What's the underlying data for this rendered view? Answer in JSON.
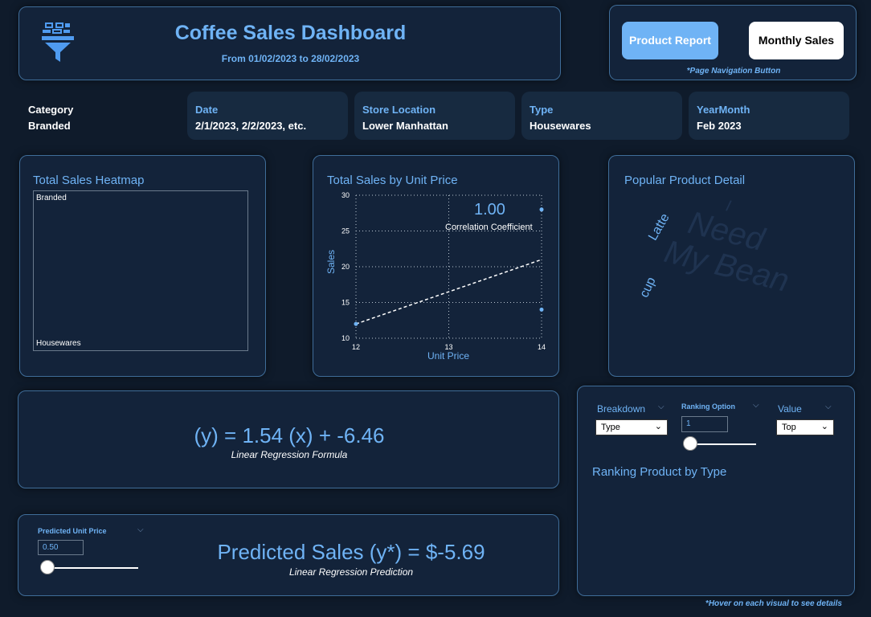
{
  "header": {
    "title": "Coffee Sales Dashboard",
    "subtitle": "From 01/02/2023 to 28/02/2023",
    "icon": "funnel-icon"
  },
  "nav": {
    "product_report": "Product Report",
    "monthly_sales": "Monthly Sales",
    "note": "*Page Navigation Button"
  },
  "filters": {
    "category": {
      "label": "Category",
      "value": "Branded"
    },
    "date": {
      "label": "Date",
      "value": "2/1/2023, 2/2/2023, etc."
    },
    "store": {
      "label": "Store Location",
      "value": "Lower Manhattan"
    },
    "type": {
      "label": "Type",
      "value": "Housewares"
    },
    "yearmonth": {
      "label": "YearMonth",
      "value": "Feb 2023"
    }
  },
  "heatmap": {
    "title": "Total Sales Heatmap",
    "top_label": "Branded",
    "bottom_label": "Housewares"
  },
  "scatter": {
    "title": "Total Sales by Unit Price",
    "correlation_value": "1.00",
    "correlation_label": "Correlation Coefficient"
  },
  "chart_data": {
    "type": "scatter",
    "title": "Total Sales by Unit Price",
    "xlabel": "Unit Price",
    "ylabel": "Sales",
    "xlim": [
      12,
      14
    ],
    "ylim": [
      10,
      30
    ],
    "x_ticks": [
      "12",
      "13",
      "14"
    ],
    "y_ticks": [
      "10",
      "15",
      "20",
      "25",
      "30"
    ],
    "points": [
      {
        "x": 12,
        "y": 12
      },
      {
        "x": 14,
        "y": 28
      },
      {
        "x": 14,
        "y": 14
      }
    ],
    "trendline": [
      {
        "x": 12,
        "y": 12
      },
      {
        "x": 14,
        "y": 21
      }
    ],
    "grid": true
  },
  "wordcloud": {
    "title": "Popular Product Detail",
    "words": [
      "Latte",
      "cup"
    ],
    "watermark_lines": [
      "I",
      "Need",
      "My Bean"
    ]
  },
  "regression": {
    "formula": "(y) = 1.54 (x) + -6.46",
    "label": "Linear Regression Formula"
  },
  "prediction": {
    "slicer_label": "Predicted Unit Price",
    "slicer_value": "0.50",
    "value": "Predicted Sales (y*) = $-5.69",
    "label": "Linear Regression Prediction"
  },
  "ranking": {
    "breakdown_label": "Breakdown",
    "breakdown_value": "Type",
    "ranking_option_label": "Ranking Option",
    "ranking_option_value": "1",
    "value_label": "Value",
    "value_value": "Top",
    "title": "Ranking Product by Type"
  },
  "footer": {
    "note": "*Hover on each visual to see details"
  },
  "colors": {
    "background": "#0f1b2b",
    "card": "#13233a",
    "border": "#3f6d99",
    "accent": "#6fb3f5"
  }
}
